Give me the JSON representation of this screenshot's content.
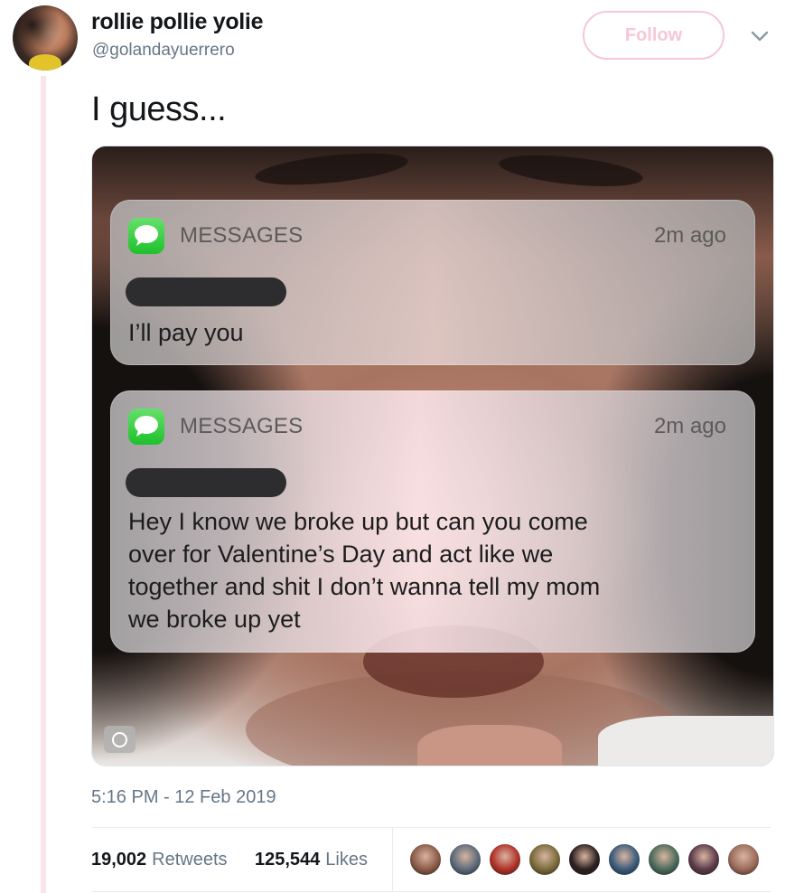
{
  "author": {
    "display_name": "rollie pollie yolie",
    "handle": "@golandayuerrero",
    "follow_label": "Follow"
  },
  "tweet": {
    "text": "I guess...",
    "timestamp": "5:16 PM - 12 Feb 2019"
  },
  "media": {
    "notifications": [
      {
        "app": "MESSAGES",
        "time": "2m ago",
        "message": "I’ll pay you"
      },
      {
        "app": "MESSAGES",
        "time": "2m ago",
        "message": "Hey I know we broke up but can you come over for Valentine’s Day and act like we together and shit I don’t wanna tell my mom we broke up yet"
      }
    ]
  },
  "stats": {
    "retweets_count": "19,002",
    "retweets_label": "Retweets",
    "likes_count": "125,544",
    "likes_label": "Likes"
  },
  "liker_avatar_colors": [
    "#8a5a48",
    "#5a6a7a",
    "#b03028",
    "#7a6a3a",
    "#2a2020",
    "#3a5a7a",
    "#4a6a5a",
    "#5a3a4a",
    "#9a6a5a"
  ],
  "colors": {
    "accent_follow": "#f6c7d6",
    "thread_line": "#f9e4ec",
    "muted_text": "#657786",
    "messages_icon": "#1dc12b"
  }
}
